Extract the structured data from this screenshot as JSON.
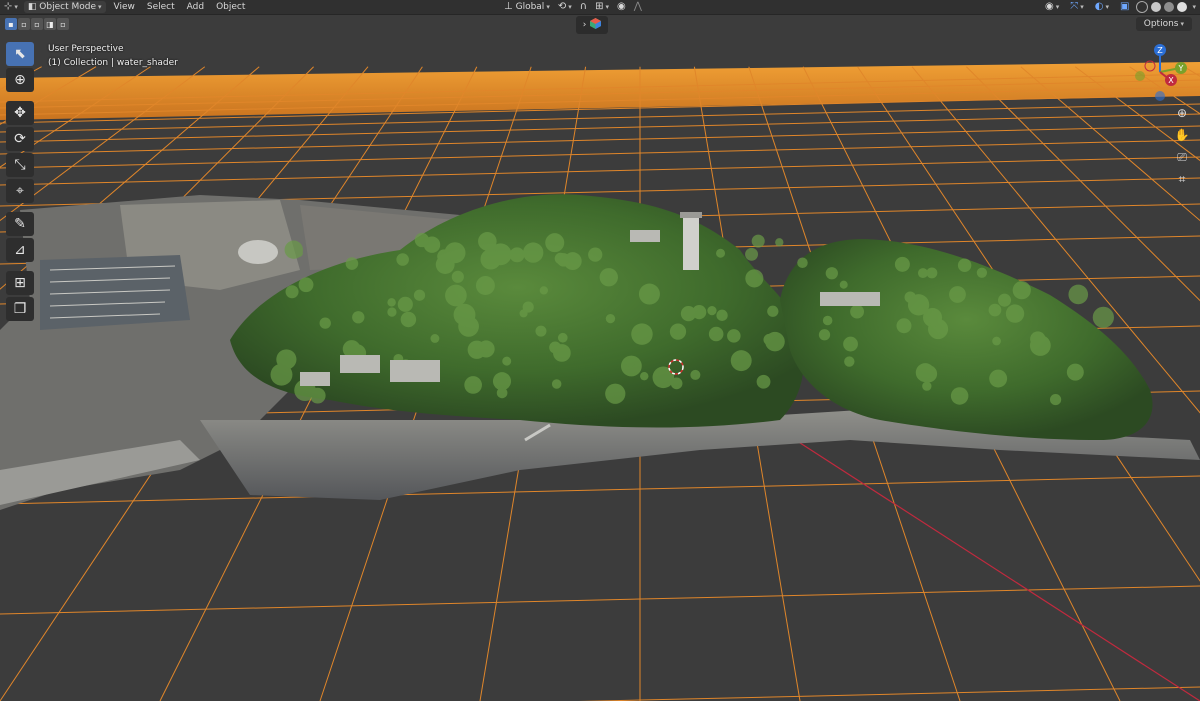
{
  "header": {
    "editor_icon": "globe-icon",
    "mode_label": "Object Mode",
    "menus": [
      "View",
      "Select",
      "Add",
      "Object"
    ],
    "orientation_label": "Global"
  },
  "toolbar_row": {
    "options_label": "Options",
    "scene_caret": "›"
  },
  "viewport": {
    "view_name": "User Perspective",
    "collection_line": "(1) Collection | water_shader"
  },
  "tools": [
    {
      "name": "select-box-tool",
      "icon": "select-arrow-icon",
      "glyph": "⬉",
      "active": true
    },
    {
      "name": "cursor-tool",
      "icon": "cursor-icon",
      "glyph": "⊕",
      "active": false
    },
    {
      "name": "move-tool",
      "icon": "move-icon",
      "glyph": "✥",
      "active": false
    },
    {
      "name": "rotate-tool",
      "icon": "rotate-icon",
      "glyph": "⟳",
      "active": false
    },
    {
      "name": "scale-tool",
      "icon": "scale-icon",
      "glyph": "⤡",
      "active": false
    },
    {
      "name": "transform-tool",
      "icon": "transform-icon",
      "glyph": "⌖",
      "active": false
    },
    {
      "name": "annotate-tool",
      "icon": "annotate-icon",
      "glyph": "✎",
      "active": false
    },
    {
      "name": "measure-tool",
      "icon": "measure-icon",
      "glyph": "⊿",
      "active": false
    },
    {
      "name": "add-cube-tool",
      "icon": "add-cube-icon",
      "glyph": "⊞",
      "active": false
    },
    {
      "name": "extra-cube-tool",
      "icon": "cube-stack-icon",
      "glyph": "❐",
      "active": false
    }
  ],
  "gizmo": {
    "x": "X",
    "y": "Y",
    "z": "Z"
  },
  "colors": {
    "accent": "#4772b3",
    "grid": "#e0862a",
    "axis_x": "#c02a3e",
    "axis_y": "#7aa02a",
    "axis_z": "#2b6fd6",
    "background": "#3c3c3c"
  }
}
